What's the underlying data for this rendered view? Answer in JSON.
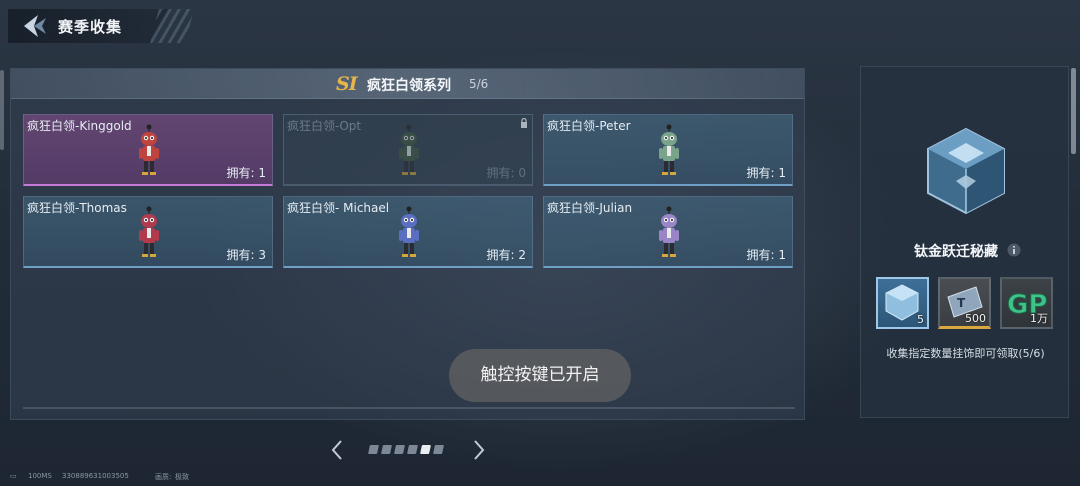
{
  "header": {
    "title": "赛季收集"
  },
  "series": {
    "logo": "SI",
    "name": "疯狂白领系列",
    "count": "5/6"
  },
  "cards": [
    {
      "name": "疯狂白领-Kinggold",
      "owned": "拥有: 1",
      "style": "pink",
      "color": "#c0443e"
    },
    {
      "name": "疯狂白领-Opt",
      "owned": "拥有: 0",
      "style": "locked",
      "color": "#3f5a3f"
    },
    {
      "name": "疯狂白领-Peter",
      "owned": "拥有: 1",
      "style": "normal",
      "color": "#7aa38c"
    },
    {
      "name": "疯狂白领-Thomas",
      "owned": "拥有: 3",
      "style": "normal",
      "color": "#b13a4c"
    },
    {
      "name": "疯狂白领- Michael",
      "owned": "拥有: 2",
      "style": "normal",
      "color": "#5b6fc2"
    },
    {
      "name": "疯狂白领-Julian",
      "owned": "拥有: 1",
      "style": "normal",
      "color": "#9a86c7"
    }
  ],
  "toast": {
    "text": "触控按键已开启"
  },
  "pagination": {
    "total": 6,
    "active": 5
  },
  "reward": {
    "chest_name": "钛金跃迁秘藏",
    "items": [
      {
        "icon": "cube-icon",
        "qty": "5"
      },
      {
        "icon": "ticket-icon",
        "qty": "500"
      },
      {
        "icon": "gp-icon",
        "label": "GP",
        "qty": "1万"
      }
    ],
    "description": "收集指定数量挂饰即可领取(5/6)"
  },
  "status": {
    "ping": "100MS",
    "id": "330889631003505",
    "quality_label": "画质:",
    "quality": "极致"
  }
}
